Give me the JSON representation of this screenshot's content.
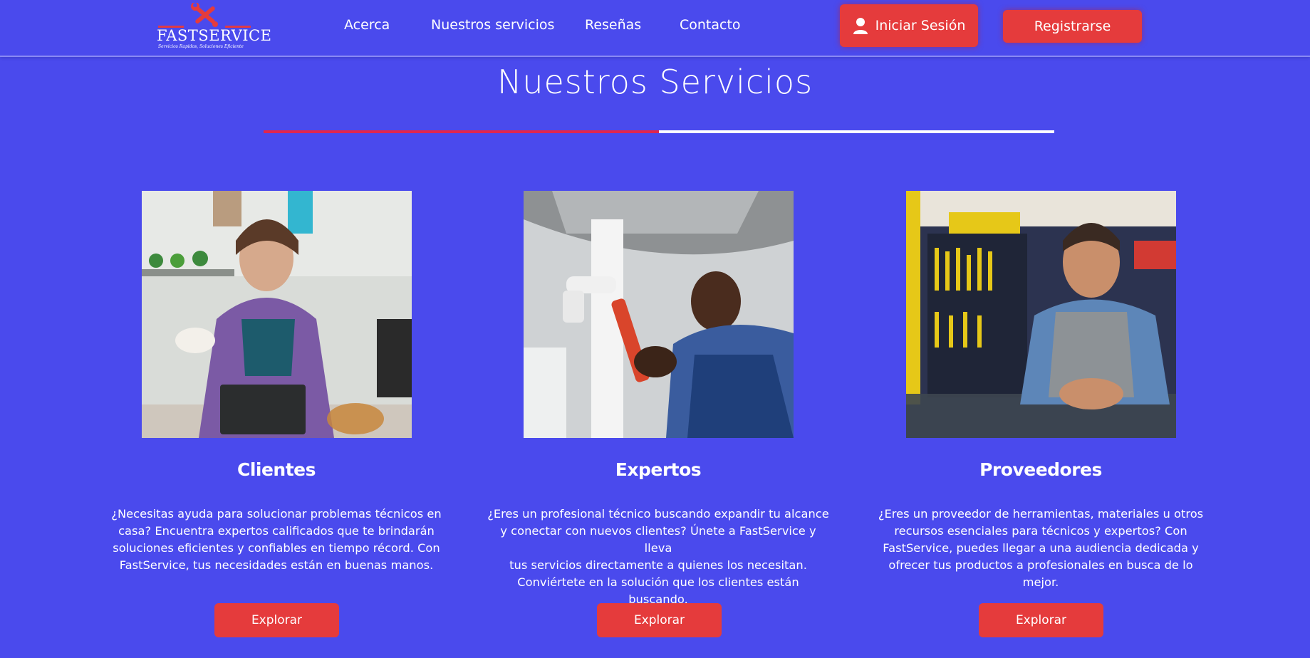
{
  "header": {
    "logo_text": "FASTSERVICE",
    "logo_tagline": "Servicios Rapidos, Soluciones Eficiente",
    "nav": [
      {
        "label": "Acerca"
      },
      {
        "label": "Nuestros servicios"
      },
      {
        "label": "Reseñas"
      },
      {
        "label": "Contacto"
      }
    ],
    "login_label": "Iniciar Sesión",
    "register_label": "Registrarse"
  },
  "section": {
    "title": "Nuestros Servicios"
  },
  "cards": [
    {
      "title": "Clientes",
      "lines": [
        "¿Necesitas ayuda para solucionar problemas técnicos en",
        "casa? Encuentra expertos calificados que te brindarán",
        "soluciones eficientes y confiables en tiempo récord. Con",
        "FastService, tus necesidades están en buenas manos."
      ],
      "button": "Explorar"
    },
    {
      "title": "Expertos",
      "lines": [
        "¿Eres un profesional técnico buscando expandir tu alcance",
        "y conectar con nuevos clientes? Únete a FastService y lleva",
        "tus servicios directamente a quienes los necesitan.",
        "Conviértete en la solución que los clientes están buscando."
      ],
      "button": "Explorar"
    },
    {
      "title": "Proveedores",
      "lines": [
        "¿Eres un proveedor de herramientas, materiales u otros",
        "recursos esenciales para técnicos y expertos? Con",
        "FastService, puedes llegar a una audiencia dedicada y",
        "ofrecer tus productos a profesionales en busca de lo mejor."
      ],
      "button": "Explorar"
    }
  ],
  "colors": {
    "background": "#4a4aed",
    "accent": "#e53b3c",
    "divider_red": "#e0264f"
  },
  "icons": {
    "logo": "wrench-screwdriver-icon",
    "login": "user-icon"
  }
}
